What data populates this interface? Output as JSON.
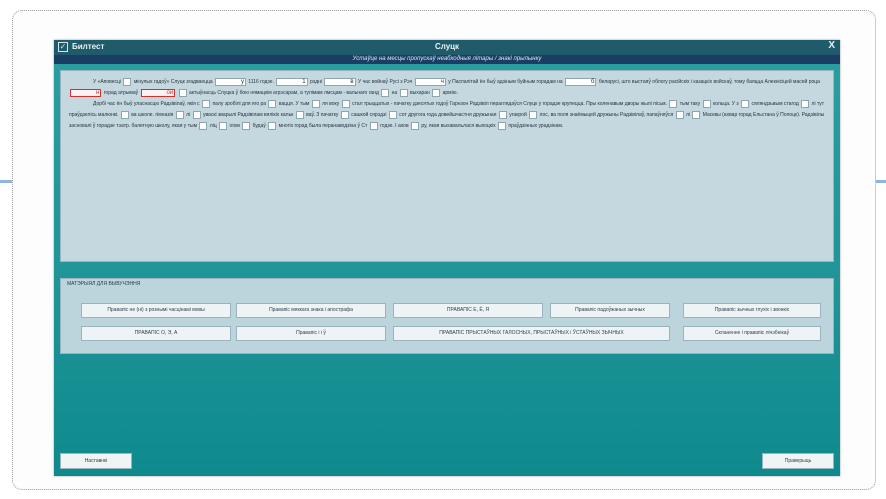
{
  "window": {
    "app_name": "Билтест",
    "title": "Слуцк",
    "close_label": "X",
    "logo_glyph": "✓"
  },
  "instruction": "Устаўце на месцы пропускаў неабходныя літары / знакі прыпынку",
  "exercise": {
    "p1": [
      "У «Аповесці",
      "мінулых гадоў» Слуцк згадваецца",
      "1116 годзе.",
      "рэдні",
      "У час войнаў Русі з Рэч",
      "у Паспалітай ён быў адзіным буйным горадам на",
      "беларусі, што выстаяў",
      "облогу расійскіх і казацкіх войскаў, тому баяцца Алекнісіцей масей роца",
      "горад атрымаў",
      "актыўнасць Слуцка ў бою нямацкім агрэсарам, а тулімам лмсцам - вальнаго ганд",
      "на",
      "выхаран",
      "армію."
    ],
    "p2": [
      "Дорбі час ён быў уласнасцю Радзівілаў, якія с",
      "палу зробілі для яго ра",
      "вацця. У тым",
      "ля воку",
      "стал трыццатых - пачатку дзесятых годоў Гарнзон",
      "Радзівіл пераглядаўся",
      "Слуцк",
      "у горадзе крупецца. Пры коленавым дворы жылі пісьм.",
      "тым таку",
      "кольца. У з",
      "сяляндзьвым стагод",
      "лі тут праўдзелісь малюнкі.",
      "ва школе. гімназія",
      "лі",
      "уваскі",
      "зварылі Радзівілам",
      "вялікіх кальк",
      "ваў. З пачатку",
      "сашкой сярэдзі",
      "сот другога года довейшчастня дружыная",
      "угакрой",
      "лос, ва поля знаёмыцей дружыны Радзівілаў, папаўняўся",
      "лі",
      "Масквы (ахвар горад Ельстана",
      "ў Полоцк). Радзівілы засновалі ў горадзе тэатр. балетную школу, якая у тым",
      "ліц",
      "ілом",
      "будаў",
      "многіх горад была перанаводзіна ў Ст",
      "годзе. І ахов",
      "ру, якая выхавальлася выхоцкіх",
      "праўдзінных урадзінам."
    ]
  },
  "materials": {
    "title": "МАТЭРЫЯЛ ДЛЯ ВЫВУЧЭННЯ",
    "rules": [
      "Правапіс не (ні) з рознымі часцінамі мовы",
      "Правапіс мяккага знака і апострафа",
      "ПРАВАПІС Е, Ё, Я",
      "Правапіс падоўжаных зычных",
      "Правапіс зычных глухіх і звонкіх",
      "ПРАВАПІС О, Э, А",
      "Правапіс і і ў",
      "ПРАВАПІС ПРЫСТАЎНЫХ ГАЛОСНЫХ, ПРЫСТАЎНЫХ і ЎСТАЎНЫХ ЗЫЧНЫХ",
      "Скланенне і правапіс лічэбнікаў"
    ]
  },
  "buttons": {
    "settings": "Наставнкі",
    "check": "Праверыць"
  },
  "fills": {
    "b1": "у",
    "b2": "1",
    "b3": "в",
    "b4": "ч",
    "b5": "б",
    "b6": "н",
    "b7": "ой"
  },
  "colors": {
    "accent_red": "#d0312d",
    "teal": "#1f9597",
    "title_bar": "#1f5b6a",
    "instruction_bar": "#1b3d63"
  }
}
